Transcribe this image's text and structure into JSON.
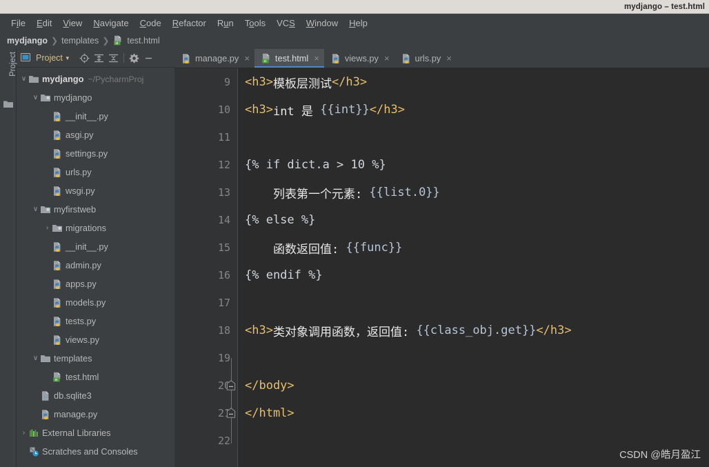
{
  "window": {
    "title": "mydjango – test.html",
    "titlebar_bg": "#dedbd6",
    "chrome_bg": "#3c3f41",
    "editor_bg": "#2b2b2b",
    "gutter_bg": "#313335",
    "accent": "#4e86c8",
    "tag_color": "#e8bf6a",
    "template_color": "#b5c5d6"
  },
  "menubar": {
    "items": [
      {
        "label": "File",
        "pre": "F",
        "mn": "i",
        "post": "le"
      },
      {
        "label": "Edit",
        "pre": "",
        "mn": "E",
        "post": "dit"
      },
      {
        "label": "View",
        "pre": "",
        "mn": "V",
        "post": "iew"
      },
      {
        "label": "Navigate",
        "pre": "",
        "mn": "N",
        "post": "avigate"
      },
      {
        "label": "Code",
        "pre": "",
        "mn": "C",
        "post": "ode"
      },
      {
        "label": "Refactor",
        "pre": "",
        "mn": "R",
        "post": "efactor"
      },
      {
        "label": "Run",
        "pre": "R",
        "mn": "u",
        "post": "n"
      },
      {
        "label": "Tools",
        "pre": "T",
        "mn": "o",
        "post": "ols"
      },
      {
        "label": "VCS",
        "pre": "VC",
        "mn": "S",
        "post": ""
      },
      {
        "label": "Window",
        "pre": "",
        "mn": "W",
        "post": "indow"
      },
      {
        "label": "Help",
        "pre": "",
        "mn": "H",
        "post": "elp"
      }
    ]
  },
  "breadcrumb": {
    "root": "mydjango",
    "folder": "templates",
    "file": "test.html",
    "separator": "❯",
    "file_icon": "html-file-icon"
  },
  "toolstrip": {
    "label": "Project",
    "folder_icon": "folder-icon"
  },
  "project_panel": {
    "title": "Project",
    "dropdown_icon": "chevron-down-icon",
    "buttons": [
      {
        "name": "locate-icon",
        "tip": "Select Opened File"
      },
      {
        "name": "expand-all-icon",
        "tip": "Expand All"
      },
      {
        "name": "collapse-all-icon",
        "tip": "Collapse All"
      },
      {
        "name": "gear-icon",
        "tip": "Settings"
      },
      {
        "name": "minimize-icon",
        "tip": "Hide"
      }
    ],
    "tree": [
      {
        "depth": 0,
        "arrow": "down",
        "icon": "folder-open-icon",
        "label": "mydjango",
        "bold": true,
        "sub": "~/PycharmProj"
      },
      {
        "depth": 1,
        "arrow": "down",
        "icon": "module-folder-icon",
        "label": "mydjango",
        "bold": false,
        "sub": ""
      },
      {
        "depth": 2,
        "arrow": "none",
        "icon": "python-file-icon",
        "label": "__init__.py",
        "bold": false,
        "sub": ""
      },
      {
        "depth": 2,
        "arrow": "none",
        "icon": "python-file-icon",
        "label": "asgi.py",
        "bold": false,
        "sub": ""
      },
      {
        "depth": 2,
        "arrow": "none",
        "icon": "python-file-icon",
        "label": "settings.py",
        "bold": false,
        "sub": ""
      },
      {
        "depth": 2,
        "arrow": "none",
        "icon": "python-file-icon",
        "label": "urls.py",
        "bold": false,
        "sub": ""
      },
      {
        "depth": 2,
        "arrow": "none",
        "icon": "python-file-icon",
        "label": "wsgi.py",
        "bold": false,
        "sub": ""
      },
      {
        "depth": 1,
        "arrow": "down",
        "icon": "module-folder-icon",
        "label": "myfirstweb",
        "bold": false,
        "sub": ""
      },
      {
        "depth": 2,
        "arrow": "right",
        "icon": "module-folder-icon",
        "label": "migrations",
        "bold": false,
        "sub": ""
      },
      {
        "depth": 2,
        "arrow": "none",
        "icon": "python-file-icon",
        "label": "__init__.py",
        "bold": false,
        "sub": ""
      },
      {
        "depth": 2,
        "arrow": "none",
        "icon": "python-file-icon",
        "label": "admin.py",
        "bold": false,
        "sub": ""
      },
      {
        "depth": 2,
        "arrow": "none",
        "icon": "python-file-icon",
        "label": "apps.py",
        "bold": false,
        "sub": ""
      },
      {
        "depth": 2,
        "arrow": "none",
        "icon": "python-file-icon",
        "label": "models.py",
        "bold": false,
        "sub": ""
      },
      {
        "depth": 2,
        "arrow": "none",
        "icon": "python-file-icon",
        "label": "tests.py",
        "bold": false,
        "sub": ""
      },
      {
        "depth": 2,
        "arrow": "none",
        "icon": "python-file-icon",
        "label": "views.py",
        "bold": false,
        "sub": ""
      },
      {
        "depth": 1,
        "arrow": "down",
        "icon": "folder-open-icon",
        "label": "templates",
        "bold": false,
        "sub": ""
      },
      {
        "depth": 2,
        "arrow": "none",
        "icon": "html-file-icon",
        "label": "test.html",
        "bold": false,
        "sub": ""
      },
      {
        "depth": 1,
        "arrow": "none",
        "icon": "db-file-icon",
        "label": "db.sqlite3",
        "bold": false,
        "sub": ""
      },
      {
        "depth": 1,
        "arrow": "none",
        "icon": "python-file-icon",
        "label": "manage.py",
        "bold": false,
        "sub": ""
      },
      {
        "depth": 0,
        "arrow": "right",
        "icon": "libraries-icon",
        "label": "External Libraries",
        "bold": false,
        "sub": ""
      },
      {
        "depth": 0,
        "arrow": "none",
        "icon": "scratches-icon",
        "label": "Scratches and Consoles",
        "bold": false,
        "sub": ""
      }
    ]
  },
  "editor": {
    "tabs": [
      {
        "label": "manage.py",
        "icon": "python-file-icon",
        "active": false,
        "close_icon": "close-icon"
      },
      {
        "label": "test.html",
        "icon": "html-file-icon",
        "active": true,
        "close_icon": "close-icon"
      },
      {
        "label": "views.py",
        "icon": "python-file-icon",
        "active": false,
        "close_icon": "close-icon"
      },
      {
        "label": "urls.py",
        "icon": "python-file-icon",
        "active": false,
        "close_icon": "close-icon"
      }
    ],
    "first_visible_line": 9,
    "lines": [
      {
        "n": 9,
        "fold": "none",
        "spans": [
          {
            "c": "tag",
            "t": "<h3>"
          },
          {
            "c": "txt",
            "t": "模板层测试"
          },
          {
            "c": "tag",
            "t": "</h3>"
          }
        ]
      },
      {
        "n": 10,
        "fold": "none",
        "spans": [
          {
            "c": "tag",
            "t": "<h3>"
          },
          {
            "c": "txt",
            "t": "int 是 "
          },
          {
            "c": "tpl",
            "t": "{{int}}"
          },
          {
            "c": "tag",
            "t": "</h3>"
          }
        ]
      },
      {
        "n": 11,
        "fold": "none",
        "spans": []
      },
      {
        "n": 12,
        "fold": "none",
        "spans": [
          {
            "c": "plain",
            "t": "{% if dict.a > 10 %}"
          }
        ]
      },
      {
        "n": 13,
        "fold": "none",
        "spans": [
          {
            "c": "txt",
            "t": "    列表第一个元素: "
          },
          {
            "c": "tpl",
            "t": "{{list.0}}"
          }
        ]
      },
      {
        "n": 14,
        "fold": "none",
        "spans": [
          {
            "c": "plain",
            "t": "{% else %}"
          }
        ]
      },
      {
        "n": 15,
        "fold": "none",
        "spans": [
          {
            "c": "txt",
            "t": "    函数返回值: "
          },
          {
            "c": "tpl",
            "t": "{{func}}"
          }
        ]
      },
      {
        "n": 16,
        "fold": "none",
        "spans": [
          {
            "c": "plain",
            "t": "{% endif %}"
          }
        ]
      },
      {
        "n": 17,
        "fold": "none",
        "spans": []
      },
      {
        "n": 18,
        "fold": "none",
        "spans": [
          {
            "c": "tag",
            "t": "<h3>"
          },
          {
            "c": "txt",
            "t": "类对象调用函数，返回值: "
          },
          {
            "c": "tpl",
            "t": "{{class_obj.get}}"
          },
          {
            "c": "tag",
            "t": "</h3>"
          }
        ]
      },
      {
        "n": 19,
        "fold": "none",
        "spans": []
      },
      {
        "n": 20,
        "fold": "collapse",
        "spans": [
          {
            "c": "tag",
            "t": "</body>"
          }
        ]
      },
      {
        "n": 21,
        "fold": "collapse",
        "spans": [
          {
            "c": "tag",
            "t": "</html>"
          }
        ]
      },
      {
        "n": 22,
        "fold": "none",
        "spans": []
      }
    ]
  },
  "watermark": {
    "text": "CSDN @皓月盈江"
  }
}
